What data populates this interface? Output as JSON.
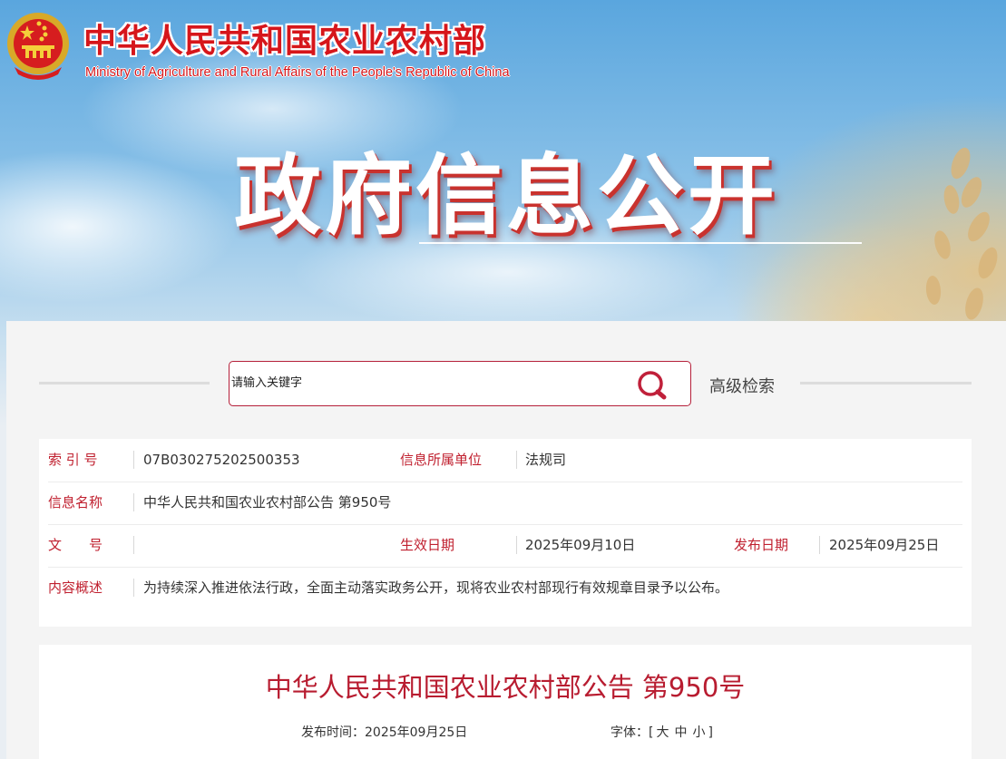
{
  "header": {
    "ministry_cn": "中华人民共和国农业农村部",
    "ministry_en": "Ministry of Agriculture and Rural Affairs of the People's Republic of China",
    "banner_title": "政府信息公开"
  },
  "search": {
    "placeholder": "请输入关键字",
    "advanced_label": "高级检索"
  },
  "meta": {
    "index_label": "索 引 号",
    "index_value": "07B030275202500353",
    "unit_label": "信息所属单位",
    "unit_value": "法规司",
    "name_label": "信息名称",
    "name_value": "中华人民共和国农业农村部公告 第950号",
    "doc_label": "文　　号",
    "doc_value": "",
    "effective_label": "生效日期",
    "effective_value": "2025年09月10日",
    "publish_label": "发布日期",
    "publish_value": "2025年09月25日",
    "summary_label": "内容概述",
    "summary_value": "为持续深入推进依法行政，全面主动落实政务公开，现将农业农村部现行有效规章目录予以公布。"
  },
  "article": {
    "title": "中华人民共和国农业农村部公告 第950号",
    "publish_time_label": "发布时间：",
    "publish_time_value": "2025年09月25日",
    "font_label": "字体：",
    "font_open": "[",
    "font_large": "大",
    "font_medium": "中",
    "font_small": "小",
    "font_close": "]"
  },
  "colors": {
    "accent_red": "#c0202f",
    "title_red": "#b81c30",
    "brand_red": "#d6161b"
  },
  "icons": {
    "emblem": "national-emblem-icon",
    "search": "search-icon"
  }
}
